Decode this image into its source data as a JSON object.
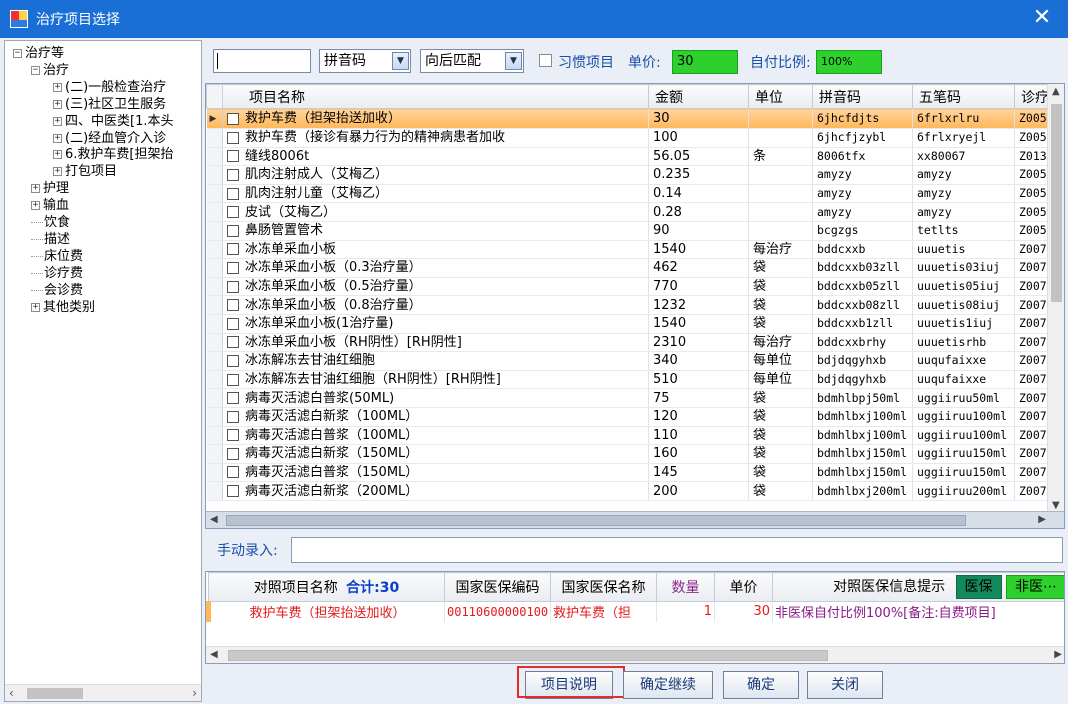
{
  "window": {
    "title": "治疗项目选择",
    "close_label": "✕"
  },
  "tree": {
    "nodes": [
      {
        "label": "治疗等",
        "level": 0,
        "expander": "-"
      },
      {
        "label": "治疗",
        "level": 1,
        "expander": "-"
      },
      {
        "label": "(二)一般检查治疗",
        "level": 2,
        "expander": "+"
      },
      {
        "label": "(三)社区卫生服务",
        "level": 2,
        "expander": "+"
      },
      {
        "label": "四、中医类[1.本头",
        "level": 2,
        "expander": "+"
      },
      {
        "label": "(二)经血管介入诊",
        "level": 2,
        "expander": "+"
      },
      {
        "label": "6.救护车费[担架抬",
        "level": 2,
        "expander": "+"
      },
      {
        "label": "打包项目",
        "level": 2,
        "expander": "+"
      },
      {
        "label": "护理",
        "level": 1,
        "expander": "+"
      },
      {
        "label": "输血",
        "level": 1,
        "expander": "+"
      },
      {
        "label": "饮食",
        "level": 1,
        "expander": ""
      },
      {
        "label": "描述",
        "level": 1,
        "expander": ""
      },
      {
        "label": "床位费",
        "level": 1,
        "expander": ""
      },
      {
        "label": "诊疗费",
        "level": 1,
        "expander": ""
      },
      {
        "label": "会诊费",
        "level": 1,
        "expander": ""
      },
      {
        "label": "其他类别",
        "level": 1,
        "expander": "+"
      }
    ]
  },
  "toolbar": {
    "search_value": "",
    "code_type": "拼音码",
    "match_mode": "向后匹配",
    "habit_label": "习惯项目",
    "price_label": "单价:",
    "price_value": "30",
    "ratio_label": "自付比例:",
    "ratio_value": "100%"
  },
  "grid": {
    "columns": [
      "项目名称",
      "金额",
      "单位",
      "拼音码",
      "五笔码",
      "诊疗"
    ],
    "rows": [
      {
        "name": "救护车费（担架抬送加收）",
        "amount": "30",
        "unit": "",
        "py": "6jhcfdjts",
        "wb": "6frlxrlru",
        "code": "Z005"
      },
      {
        "name": "救护车费（接诊有暴力行为的精神病患者加收",
        "amount": "100",
        "unit": "",
        "py": "6jhcfjzybl",
        "wb": "6frlxryejl",
        "code": "Z005"
      },
      {
        "name": "缝线8006t",
        "amount": "56.05",
        "unit": "条",
        "py": "8006tfx",
        "wb": "xx80067",
        "code": "Z013"
      },
      {
        "name": "肌肉注射成人（艾梅乙）",
        "amount": "0.235",
        "unit": "",
        "py": "amyzy",
        "wb": "amyzy",
        "code": "Z005"
      },
      {
        "name": "肌肉注射儿童（艾梅乙）",
        "amount": "0.14",
        "unit": "",
        "py": "amyzy",
        "wb": "amyzy",
        "code": "Z005"
      },
      {
        "name": "皮试（艾梅乙）",
        "amount": "0.28",
        "unit": "",
        "py": "amyzy",
        "wb": "amyzy",
        "code": "Z005"
      },
      {
        "name": "鼻肠管置管术",
        "amount": "90",
        "unit": "",
        "py": "bcgzgs",
        "wb": "tetlts",
        "code": "Z005"
      },
      {
        "name": "冰冻单采血小板",
        "amount": "1540",
        "unit": "每治疗",
        "py": "bddcxxb",
        "wb": "uuuetis",
        "code": "Z007"
      },
      {
        "name": "冰冻单采血小板（0.3治疗量）",
        "amount": "462",
        "unit": "袋",
        "py": "bddcxxb03zll",
        "wb": "uuuetis03iuj",
        "code": "Z007"
      },
      {
        "name": "冰冻单采血小板（0.5治疗量）",
        "amount": "770",
        "unit": "袋",
        "py": "bddcxxb05zll",
        "wb": "uuuetis05iuj",
        "code": "Z007"
      },
      {
        "name": "冰冻单采血小板（0.8治疗量）",
        "amount": "1232",
        "unit": "袋",
        "py": "bddcxxb08zll",
        "wb": "uuuetis08iuj",
        "code": "Z007"
      },
      {
        "name": "冰冻单采血小板(1治疗量)",
        "amount": "1540",
        "unit": "袋",
        "py": "bddcxxb1zll",
        "wb": "uuuetis1iuj",
        "code": "Z007"
      },
      {
        "name": "冰冻单采血小板（RH阴性）[RH阴性]",
        "amount": "2310",
        "unit": "每治疗",
        "py": "bddcxxbrhy",
        "wb": "uuuetisrhb",
        "code": "Z007"
      },
      {
        "name": "冰冻解冻去甘油红细胞",
        "amount": "340",
        "unit": "每单位",
        "py": "bdjdqgyhxb",
        "wb": "uuqufaixxe",
        "code": "Z007"
      },
      {
        "name": "冰冻解冻去甘油红细胞（RH阴性）[RH阴性]",
        "amount": "510",
        "unit": "每单位",
        "py": "bdjdqgyhxb",
        "wb": "uuqufaixxe",
        "code": "Z007"
      },
      {
        "name": "病毒灭活滤白普浆(50ML)",
        "amount": "75",
        "unit": "袋",
        "py": "bdmhlbpj50ml",
        "wb": "uggiiruu50ml",
        "code": "Z007"
      },
      {
        "name": "病毒灭活滤白新浆（100ML）",
        "amount": "120",
        "unit": "袋",
        "py": "bdmhlbxj100ml",
        "wb": "uggiiruu100ml",
        "code": "Z007"
      },
      {
        "name": "病毒灭活滤白普浆（100ML）",
        "amount": "110",
        "unit": "袋",
        "py": "bdmhlbxj100ml",
        "wb": "uggiiruu100ml",
        "code": "Z007"
      },
      {
        "name": "病毒灭活滤白新浆（150ML）",
        "amount": "160",
        "unit": "袋",
        "py": "bdmhlbxj150ml",
        "wb": "uggiiruu150ml",
        "code": "Z007"
      },
      {
        "name": "病毒灭活滤白普浆（150ML）",
        "amount": "145",
        "unit": "袋",
        "py": "bdmhlbxj150ml",
        "wb": "uggiiruu150ml",
        "code": "Z007"
      },
      {
        "name": "病毒灭活滤白新浆（200ML）",
        "amount": "200",
        "unit": "袋",
        "py": "bdmhlbxj200ml",
        "wb": "uggiiruu200ml",
        "code": "Z007"
      }
    ]
  },
  "manual": {
    "label": "手动录入:",
    "value": ""
  },
  "lower": {
    "col_name": "对照项目名称",
    "total_label": "合计:30",
    "col_national_code": "国家医保编码",
    "col_national_name": "国家医保名称",
    "col_qty": "数量",
    "col_price": "单价",
    "col_hint": "对照医保信息提示",
    "btn_insured": "医保",
    "btn_noninsured": "非医⋯",
    "row": {
      "name": "救护车费（担架抬送加收）",
      "national_code": "00110600000100",
      "national_name": "救护车费（担",
      "qty": "1",
      "price": "30",
      "hint": "非医保自付比例100%[备注:自费项目]"
    }
  },
  "buttons": {
    "explain": "项目说明",
    "confirm_continue": "确定继续",
    "confirm": "确定",
    "close": "关闭"
  },
  "colors": {
    "titlebar": "#1a6fd7",
    "selected_row": "#ffb75a",
    "green": "#2ed02e",
    "red_text": "#e41a1a",
    "dark_green": "#148a5c"
  }
}
